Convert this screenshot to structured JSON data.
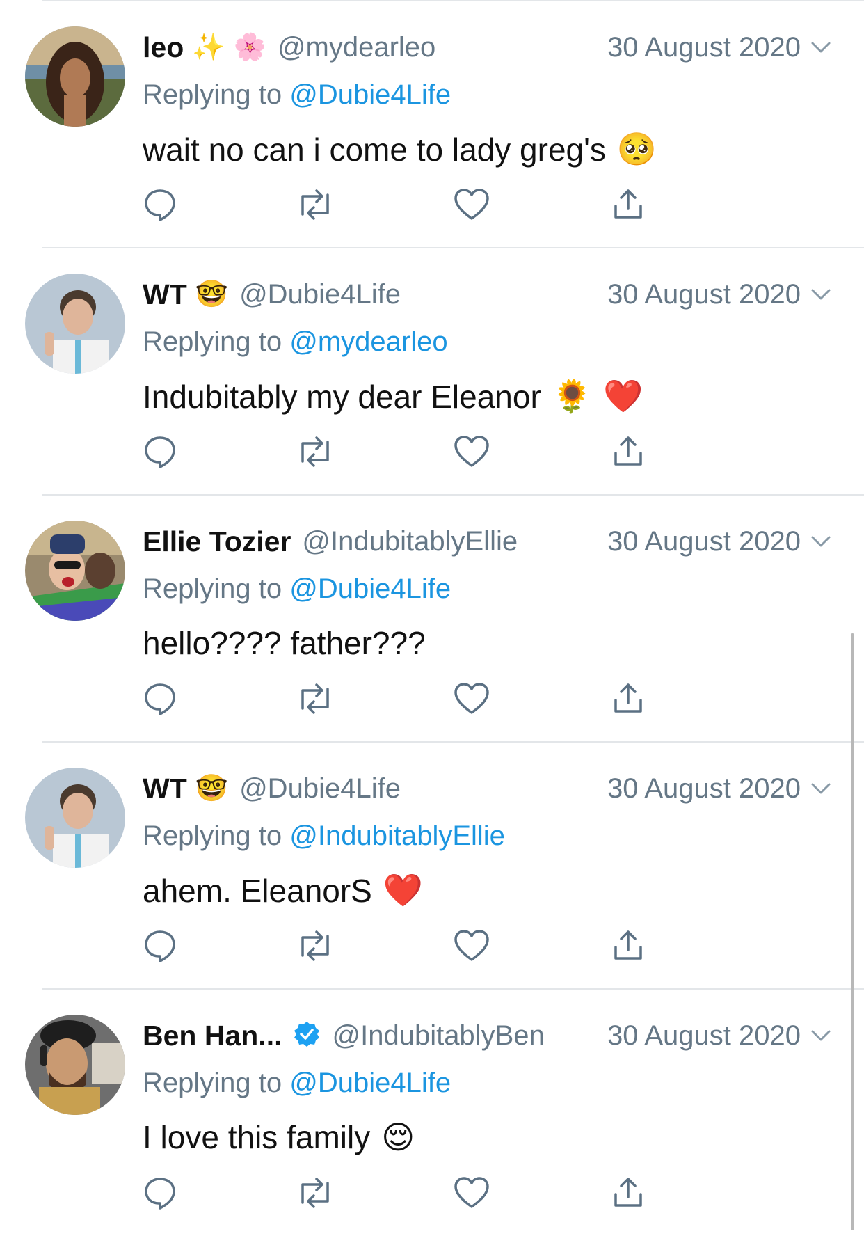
{
  "tweets": [
    {
      "name": "leo",
      "name_emojis": [
        "✨",
        "🌸"
      ],
      "handle": "@mydearleo",
      "date": "30 August 2020",
      "replying_prefix": "Replying to",
      "replying_to": "@Dubie4Life",
      "text": "wait no can i come to lady greg's",
      "text_emojis": [
        "🥺"
      ],
      "verified": false
    },
    {
      "name": "WT",
      "name_emojis": [
        "🤓"
      ],
      "handle": "@Dubie4Life",
      "date": "30 August 2020",
      "replying_prefix": "Replying to",
      "replying_to": "@mydearleo",
      "text": "Indubitably my dear Eleanor",
      "text_emojis": [
        "🌻",
        "❤️"
      ],
      "verified": false
    },
    {
      "name": "Ellie Tozier",
      "name_emojis": [],
      "handle": "@IndubitablyEllie",
      "date": "30 August 2020",
      "replying_prefix": "Replying to",
      "replying_to": "@Dubie4Life",
      "text": "hello???? father???",
      "text_emojis": [],
      "verified": false
    },
    {
      "name": "WT",
      "name_emojis": [
        "🤓"
      ],
      "handle": "@Dubie4Life",
      "date": "30 August 2020",
      "replying_prefix": "Replying to",
      "replying_to": "@IndubitablyEllie",
      "text": "ahem. EleanorS",
      "text_emojis": [
        "❤️"
      ],
      "verified": false
    },
    {
      "name": "Ben Han...",
      "name_emojis": [],
      "handle": "@IndubitablyBen",
      "date": "30 August 2020",
      "replying_prefix": "Replying to",
      "replying_to": "@Dubie4Life",
      "text": "I love this family",
      "text_emojis": [
        "😌"
      ],
      "verified": true
    }
  ],
  "colors": {
    "link": "#1b95e0",
    "secondary_text": "#657786",
    "divider": "#e3e6e9",
    "verified": "#1da1f2"
  }
}
